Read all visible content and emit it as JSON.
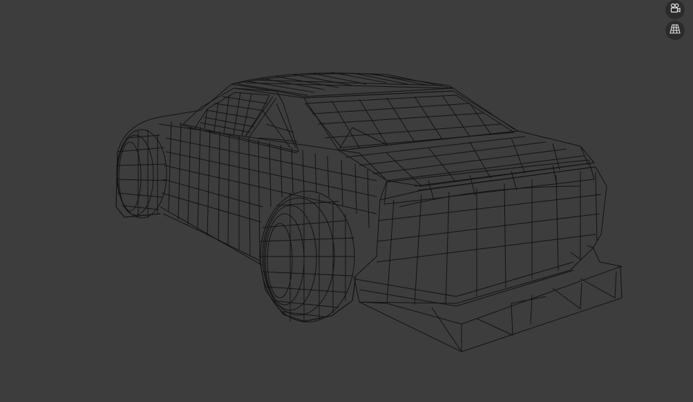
{
  "viewport": {
    "background_color": "#3d3d3d",
    "wire_color": "#121212",
    "shading": "wireframe",
    "subject": "car-mesh"
  },
  "navigation_gizmo": {
    "camera_button_icon": "camera-view-icon",
    "perspective_button_icon": "perspective-grid-icon"
  }
}
